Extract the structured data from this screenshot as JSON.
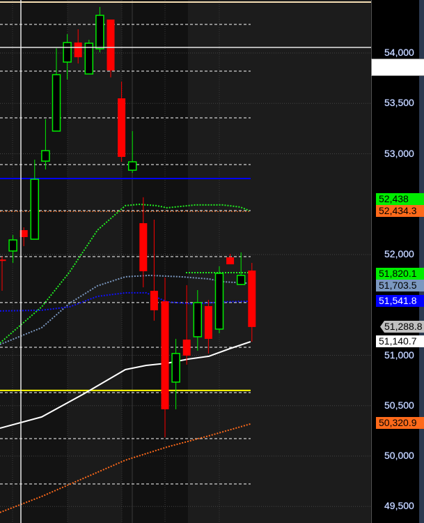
{
  "chart_data": {
    "type": "candlestick",
    "title": "",
    "ylim": [
      49350,
      54550
    ],
    "y_ticks": [
      {
        "value": 54000,
        "label": "54,000"
      },
      {
        "value": 53500,
        "label": "53,500"
      },
      {
        "value": 53000,
        "label": "53,000"
      },
      {
        "value": 52000,
        "label": "52,000"
      },
      {
        "value": 51000,
        "label": "51,000"
      },
      {
        "value": 50500,
        "label": "50,500"
      },
      {
        "value": 50000,
        "label": "50,000"
      },
      {
        "value": 49500,
        "label": "49,500"
      }
    ],
    "candles": [
      {
        "o": 51950,
        "h": 51979,
        "l": 51640,
        "c": 51938
      },
      {
        "o": 52035,
        "h": 52194,
        "l": 51917,
        "c": 52145
      },
      {
        "o": 52242,
        "h": 52270,
        "l": 52083,
        "c": 52173
      },
      {
        "o": 52152,
        "h": 52941,
        "l": 52152,
        "c": 52747
      },
      {
        "o": 52927,
        "h": 53343,
        "l": 52844,
        "c": 53031
      },
      {
        "o": 53225,
        "h": 54048,
        "l": 53225,
        "c": 53785
      },
      {
        "o": 53910,
        "h": 54187,
        "l": 53737,
        "c": 54104
      },
      {
        "o": 54104,
        "h": 54235,
        "l": 53896,
        "c": 53958
      },
      {
        "o": 53792,
        "h": 54131,
        "l": 53792,
        "c": 54097
      },
      {
        "o": 54042,
        "h": 54457,
        "l": 54007,
        "c": 54374
      },
      {
        "o": 54332,
        "h": 54332,
        "l": 53758,
        "c": 53827
      },
      {
        "o": 53550,
        "h": 53716,
        "l": 52920,
        "c": 52969
      },
      {
        "o": 52837,
        "h": 53225,
        "l": 52810,
        "c": 52920
      },
      {
        "o": 52311,
        "h": 52568,
        "l": 51675,
        "c": 51834
      },
      {
        "o": 51640,
        "h": 52346,
        "l": 51343,
        "c": 51447
      },
      {
        "o": 51536,
        "h": 51772,
        "l": 50187,
        "c": 50464
      },
      {
        "o": 50734,
        "h": 51163,
        "l": 50464,
        "c": 51018
      },
      {
        "o": 51156,
        "h": 51696,
        "l": 50907,
        "c": 50997
      },
      {
        "o": 51184,
        "h": 51647,
        "l": 51045,
        "c": 51523
      },
      {
        "o": 51488,
        "h": 51550,
        "l": 51018,
        "c": 51163
      },
      {
        "o": 51260,
        "h": 51882,
        "l": 51218,
        "c": 51813
      },
      {
        "o": 51972,
        "h": 52007,
        "l": 51903,
        "c": 51903
      },
      {
        "o": 51703,
        "h": 52021,
        "l": 51696,
        "c": 51793
      },
      {
        "o": 51841,
        "h": 51917,
        "l": 51135,
        "c": 51281
      }
    ],
    "indicators": [
      {
        "name": "white-ma",
        "color": "#ffffff",
        "style": "solid",
        "width": 2,
        "points": [
          [
            -0.2,
            50277
          ],
          [
            3.65,
            50388
          ],
          [
            7.5,
            50616
          ],
          [
            11.35,
            50858
          ],
          [
            13.27,
            50900
          ],
          [
            15.19,
            50921
          ],
          [
            17.12,
            50962
          ],
          [
            19.04,
            50990
          ],
          [
            20.96,
            51066
          ],
          [
            22.88,
            51135
          ]
        ]
      },
      {
        "name": "orange-ma",
        "color": "#ff6a1a",
        "style": "dotted",
        "width": 2,
        "points": [
          [
            -0.2,
            49440
          ],
          [
            3.65,
            49599
          ],
          [
            7.5,
            49779
          ],
          [
            11.35,
            49959
          ],
          [
            15.19,
            50090
          ],
          [
            19.04,
            50201
          ],
          [
            22.88,
            50319
          ]
        ]
      },
      {
        "name": "green-ma",
        "color": "#22ee22",
        "style": "dotted",
        "width": 2,
        "points": [
          [
            -0.2,
            51121
          ],
          [
            3.65,
            51481
          ],
          [
            6.22,
            51827
          ],
          [
            8.78,
            52242
          ],
          [
            11.35,
            52485
          ],
          [
            12.63,
            52498
          ],
          [
            14.23,
            52485
          ],
          [
            15.19,
            52464
          ],
          [
            17.76,
            52492
          ],
          [
            20.32,
            52492
          ],
          [
            21.92,
            52471
          ],
          [
            22.76,
            52436
          ]
        ]
      },
      {
        "name": "slate-ma",
        "color": "#7b98c0",
        "style": "dotted",
        "width": 2,
        "points": [
          [
            -0.2,
            51107
          ],
          [
            3.65,
            51274
          ],
          [
            6.22,
            51516
          ],
          [
            8.78,
            51689
          ],
          [
            11.35,
            51779
          ],
          [
            13.59,
            51793
          ],
          [
            16.47,
            51779
          ],
          [
            19.04,
            51758
          ],
          [
            20.32,
            51730
          ],
          [
            22.56,
            51716
          ]
        ]
      },
      {
        "name": "blue-ma",
        "color": "#1010ff",
        "style": "dotted",
        "width": 2,
        "points": [
          [
            -0.2,
            51440
          ],
          [
            3.65,
            51447
          ],
          [
            6.22,
            51481
          ],
          [
            8.78,
            51585
          ],
          [
            11.35,
            51620
          ],
          [
            13.27,
            51620
          ],
          [
            15.19,
            51530
          ],
          [
            17.76,
            51509
          ],
          [
            20.32,
            51530
          ],
          [
            22.88,
            51536
          ]
        ]
      }
    ],
    "levels": {
      "dashed": [
        54284,
        53820,
        53356,
        52893,
        52436,
        51979,
        51523,
        51080,
        50630,
        50173,
        49723
      ],
      "yellow": 50651,
      "blue": 52754,
      "crosshair_price": 54055,
      "green_short": 51820
    },
    "price_tags": [
      {
        "label": "52,438",
        "bg": "#00ee00",
        "fg": "#000000",
        "value": 52438
      },
      {
        "label": "52,434.3",
        "bg": "#ff6a1a",
        "fg": "#000000",
        "value": 52434.3
      },
      {
        "label": "51,820.1",
        "bg": "#00ee00",
        "fg": "#000000",
        "value": 51820.1
      },
      {
        "label": "51,703.5",
        "bg": "#7b98c0",
        "fg": "#000000",
        "value": 51703.5
      },
      {
        "label": "51,541.8",
        "bg": "#0000ff",
        "fg": "#ffffff",
        "value": 51541.8
      },
      {
        "label": "51,288.8",
        "bg": "#c0c0c0",
        "fg": "#000000",
        "value": 51288.8
      },
      {
        "label": "51,140.7",
        "bg": "#ffffff",
        "fg": "#000000",
        "value": 51140.7
      },
      {
        "label": "50,320.9",
        "bg": "#ff6a1a",
        "fg": "#000000",
        "value": 50320.9
      }
    ],
    "colors": {
      "up": "#00ee00",
      "down": "#ff0000",
      "yellow": "#ffff00",
      "blue": "#0000ff"
    }
  }
}
